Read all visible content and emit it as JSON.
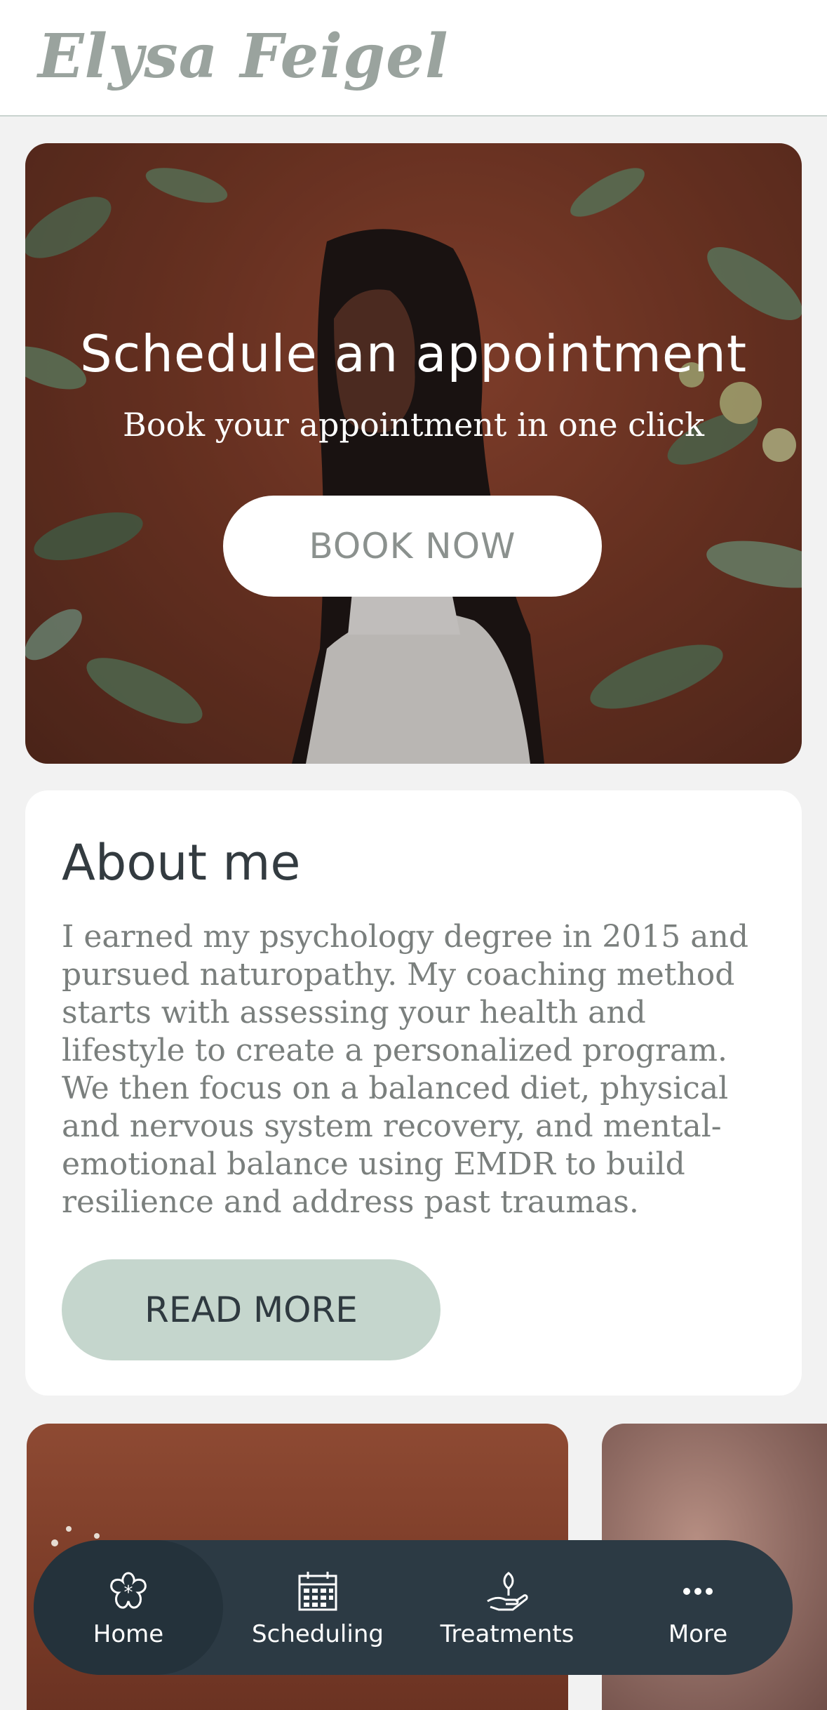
{
  "header": {
    "brand": "Elysa Feigel"
  },
  "hero": {
    "title": "Schedule an appointment",
    "subtitle": "Book your appointment in one click",
    "button_label": "BOOK NOW"
  },
  "about": {
    "title": "About me",
    "body": "I earned my psychology degree in 2015 and pursued naturopathy. My coaching method starts with assessing your health and lifestyle to create a personalized program. We then focus on a balanced diet, physical and nervous system recovery, and mental-emotional balance using EMDR to build resilience and address past traumas.",
    "button_label": "READ MORE"
  },
  "nav": {
    "items": [
      {
        "label": "Home",
        "icon": "flower-icon",
        "active": true
      },
      {
        "label": "Scheduling",
        "icon": "calendar-icon",
        "active": false
      },
      {
        "label": "Treatments",
        "icon": "hand-plant-icon",
        "active": false
      },
      {
        "label": "More",
        "icon": "more-dots-icon",
        "active": false
      }
    ]
  },
  "colors": {
    "header_bg": "#ffffff",
    "page_bg": "#f2f2f2",
    "nav_bg": "#2c3a44",
    "read_more_bg": "#c5d6cd",
    "hero_accent": "#7d3a26"
  }
}
